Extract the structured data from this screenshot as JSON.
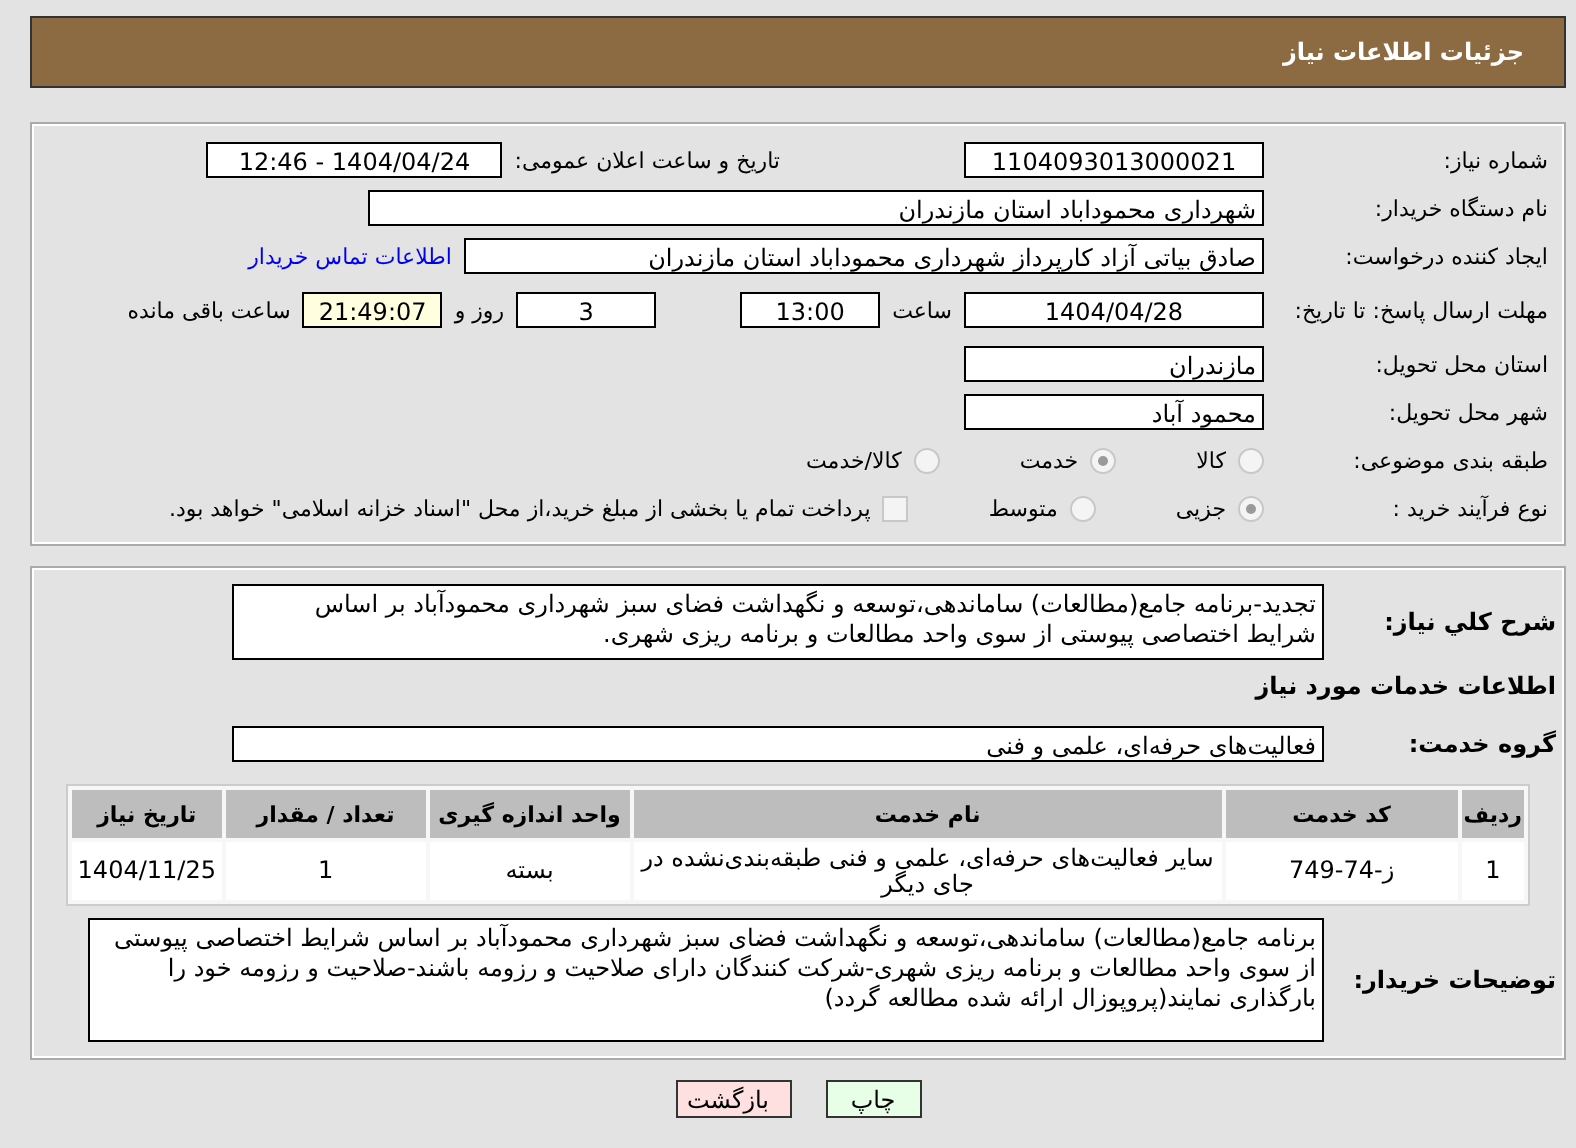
{
  "header": {
    "title": "جزئیات اطلاعات نیاز"
  },
  "need_number": {
    "label": "شماره نیاز:",
    "value": "1104093013000021"
  },
  "announce": {
    "label": "تاریخ و ساعت اعلان عمومی:",
    "value": "1404/04/24 - 12:46"
  },
  "buyer_org": {
    "label": "نام دستگاه خریدار:",
    "value": "شهرداری محموداباد استان مازندران"
  },
  "requester": {
    "label": "ایجاد کننده درخواست:",
    "value": "صادق بیاتی آزاد کارپرداز شهرداری محموداباد استان مازندران",
    "link": "اطلاعات تماس خریدار"
  },
  "deadline": {
    "label": "مهلت ارسال پاسخ: تا تاریخ:",
    "date": "1404/04/28",
    "time_label": "ساعت",
    "time": "13:00",
    "days": "3",
    "days_label": "روز و",
    "remaining": "21:49:07",
    "remaining_label": "ساعت باقی مانده"
  },
  "province": {
    "label": "استان محل تحویل:",
    "value": "مازندران"
  },
  "city": {
    "label": "شهر محل تحویل:",
    "value": "محمود آباد"
  },
  "category": {
    "label": "طبقه بندی موضوعی:",
    "options": [
      {
        "label": "کالا",
        "selected": false
      },
      {
        "label": "خدمت",
        "selected": true
      },
      {
        "label": "کالا/خدمت",
        "selected": false
      }
    ]
  },
  "process": {
    "label": "نوع فرآیند خرید :",
    "options": [
      {
        "label": "جزیی",
        "selected": true
      },
      {
        "label": "متوسط",
        "selected": false
      }
    ],
    "payment": {
      "checked": false,
      "text": "پرداخت تمام یا بخشی از مبلغ خرید،از محل \"اسناد خزانه اسلامی\" خواهد بود."
    }
  },
  "summary": {
    "label": "شرح کلي نياز:",
    "value": "تجدید-برنامه جامع(مطالعات) ساماندهی،توسعه و نگهداشت فضای سبز شهرداری محمودآباد بر اساس شرایط اختصاصی پیوستی از سوی واحد مطالعات و برنامه ریزی شهری."
  },
  "services_title": "اطلاعات خدمات مورد نیاز",
  "service_group": {
    "label": "گروه خدمت:",
    "value": "فعالیت‌های حرفه‌ای، علمی و فنی"
  },
  "table": {
    "columns": [
      "ردیف",
      "کد خدمت",
      "نام خدمت",
      "واحد اندازه گیری",
      "تعداد / مقدار",
      "تاریخ نیاز"
    ],
    "rows": [
      [
        "1",
        "ز-74-749",
        "سایر فعالیت‌های حرفه‌ای، علمی و فنی طبقه‌بندی‌نشده در جای دیگر",
        "بسته",
        "1",
        "1404/11/25"
      ]
    ]
  },
  "buyer_notes": {
    "label": "توضیحات خریدار:",
    "value": "برنامه جامع(مطالعات) ساماندهی،توسعه و نگهداشت فضای سبز شهرداری محمودآباد بر اساس شرایط اختصاصی پیوستی از سوی واحد مطالعات و برنامه ریزی شهری-شرکت کنندگان دارای صلاحیت و رزومه باشند-صلاحیت و رزومه خود را بارگذاری نمایند(پروپوزال ارائه شده مطالعه گردد)"
  },
  "buttons": [
    {
      "kind": "print",
      "label": "چاپ"
    },
    {
      "kind": "back",
      "label": "بازگشت"
    }
  ]
}
